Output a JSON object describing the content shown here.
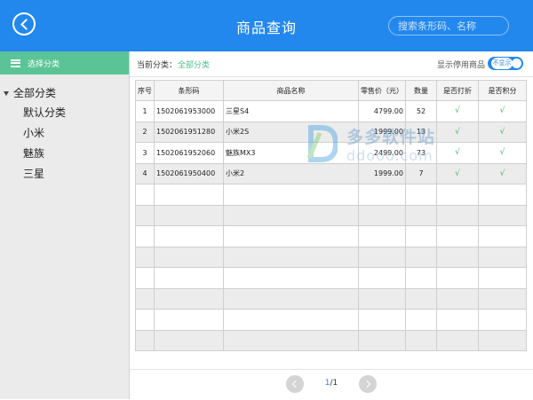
{
  "header": {
    "title": "商品查询",
    "search_placeholder": "搜索条形码、名称",
    "color": "#2388ee"
  },
  "sidebar": {
    "head_label": "选择分类",
    "head_color": "#5ac496",
    "root": "全部分类",
    "items": [
      "默认分类",
      "小米",
      "魅族",
      "三星"
    ]
  },
  "filter": {
    "label": "当前分类：",
    "value": "全部分类",
    "toggle_label": "显示停用商品",
    "toggle_text": "不显示"
  },
  "table": {
    "columns": [
      "序号",
      "条形码",
      "商品名称",
      "零售价（元）",
      "数量",
      "是否打折",
      "是否积分"
    ],
    "rows": [
      {
        "no": "1",
        "barcode": "1502061953000",
        "name": "三星S4",
        "price": "4799.00",
        "qty": "52",
        "discount": "√",
        "points": "√"
      },
      {
        "no": "2",
        "barcode": "1502061951280",
        "name": "小米2S",
        "price": "1999.00",
        "qty": "13",
        "discount": "√",
        "points": "√"
      },
      {
        "no": "3",
        "barcode": "1502061952060",
        "name": "魅族MX3",
        "price": "2499.00",
        "qty": "73",
        "discount": "√",
        "points": "√"
      },
      {
        "no": "4",
        "barcode": "1502061950400",
        "name": "小米2",
        "price": "1999.00",
        "qty": "7",
        "discount": "√",
        "points": "√"
      }
    ],
    "empty_rows": 8
  },
  "watermark": {
    "cn": "多多软件站",
    "en": "ddooo.com"
  },
  "pager": {
    "current": "1",
    "total": "/1"
  },
  "icons": {
    "back": "back-circle-icon",
    "list": "list-icon",
    "prev": "chevron-left-icon",
    "next": "chevron-right-icon"
  }
}
